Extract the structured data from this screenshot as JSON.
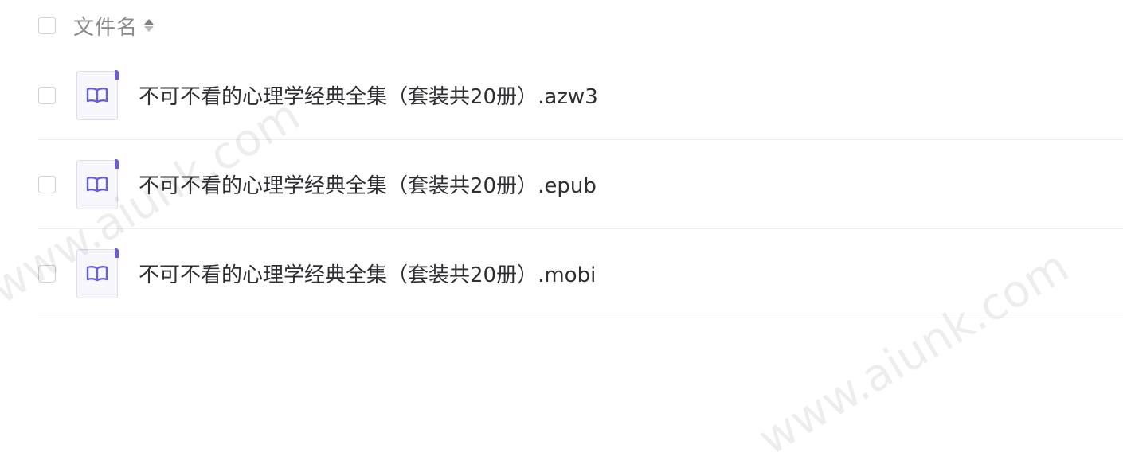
{
  "header": {
    "label": "文件名",
    "sort_icon": "sort-icon"
  },
  "files": [
    {
      "name": "不可不看的心理学经典全集（套装共20册）.azw3",
      "icon": "book-icon"
    },
    {
      "name": "不可不看的心理学经典全集（套装共20册）.epub",
      "icon": "book-icon"
    },
    {
      "name": "不可不看的心理学经典全集（套装共20册）.mobi",
      "icon": "book-icon"
    }
  ],
  "watermarks": [
    "www.aiunk.com",
    "www.aiunk.com"
  ],
  "colors": {
    "accent": "#6a5fd0",
    "icon_bg": "#f6f6fb",
    "text": "#2f2f33",
    "header_text": "#8a8a8f",
    "divider": "#eeeef0"
  }
}
